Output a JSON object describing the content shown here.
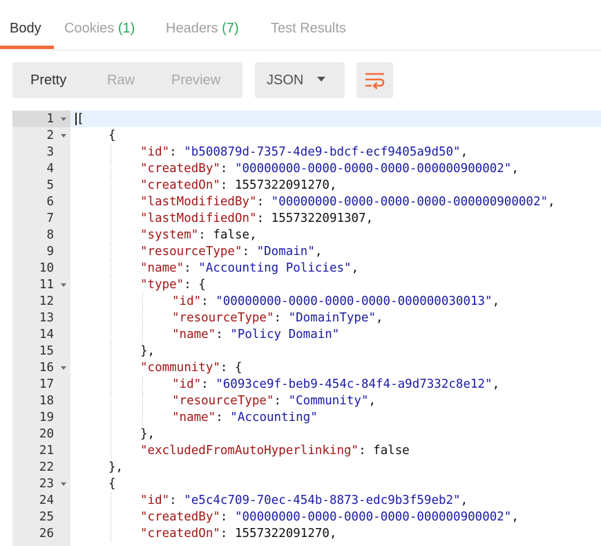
{
  "tabs": [
    {
      "label": "Body",
      "count": ""
    },
    {
      "label": "Cookies",
      "count": "(1)"
    },
    {
      "label": "Headers",
      "count": "(7)"
    },
    {
      "label": "Test Results",
      "count": ""
    }
  ],
  "view_modes": [
    "Pretty",
    "Raw",
    "Preview"
  ],
  "format": {
    "selected": "JSON"
  },
  "colors": {
    "accent": "#f26b3a",
    "count": "#26a65b",
    "key": "#a31515",
    "string": "#1a1aa6"
  },
  "icons": {
    "wrap": "wrap-lines-icon",
    "fold": "fold-arrow-icon",
    "dropdown": "chevron-down-icon"
  },
  "editor": {
    "lines": [
      {
        "n": "1",
        "i": 0,
        "fold": true,
        "p": [
          [
            "t",
            "["
          ]
        ]
      },
      {
        "n": "2",
        "i": 1,
        "fold": true,
        "p": [
          [
            "t",
            "{"
          ]
        ]
      },
      {
        "n": "3",
        "i": 2,
        "p": [
          [
            "k",
            "\"id\""
          ],
          [
            "t",
            ": "
          ],
          [
            "s",
            "\"b500879d-7357-4de9-bdcf-ecf9405a9d50\""
          ],
          [
            "t",
            ","
          ]
        ]
      },
      {
        "n": "4",
        "i": 2,
        "p": [
          [
            "k",
            "\"createdBy\""
          ],
          [
            "t",
            ": "
          ],
          [
            "s",
            "\"00000000-0000-0000-0000-000000900002\""
          ],
          [
            "t",
            ","
          ]
        ]
      },
      {
        "n": "5",
        "i": 2,
        "p": [
          [
            "k",
            "\"createdOn\""
          ],
          [
            "t",
            ": "
          ],
          [
            "n",
            "1557322091270"
          ],
          [
            "t",
            ","
          ]
        ]
      },
      {
        "n": "6",
        "i": 2,
        "p": [
          [
            "k",
            "\"lastModifiedBy\""
          ],
          [
            "t",
            ": "
          ],
          [
            "s",
            "\"00000000-0000-0000-0000-000000900002\""
          ],
          [
            "t",
            ","
          ]
        ]
      },
      {
        "n": "7",
        "i": 2,
        "p": [
          [
            "k",
            "\"lastModifiedOn\""
          ],
          [
            "t",
            ": "
          ],
          [
            "n",
            "1557322091307"
          ],
          [
            "t",
            ","
          ]
        ]
      },
      {
        "n": "8",
        "i": 2,
        "p": [
          [
            "k",
            "\"system\""
          ],
          [
            "t",
            ": "
          ],
          [
            "n",
            "false"
          ],
          [
            "t",
            ","
          ]
        ]
      },
      {
        "n": "9",
        "i": 2,
        "p": [
          [
            "k",
            "\"resourceType\""
          ],
          [
            "t",
            ": "
          ],
          [
            "s",
            "\"Domain\""
          ],
          [
            "t",
            ","
          ]
        ]
      },
      {
        "n": "10",
        "i": 2,
        "p": [
          [
            "k",
            "\"name\""
          ],
          [
            "t",
            ": "
          ],
          [
            "s",
            "\"Accounting Policies\""
          ],
          [
            "t",
            ","
          ]
        ]
      },
      {
        "n": "11",
        "i": 2,
        "fold": true,
        "p": [
          [
            "k",
            "\"type\""
          ],
          [
            "t",
            ": {"
          ]
        ]
      },
      {
        "n": "12",
        "i": 3,
        "p": [
          [
            "k",
            "\"id\""
          ],
          [
            "t",
            ": "
          ],
          [
            "s",
            "\"00000000-0000-0000-0000-000000030013\""
          ],
          [
            "t",
            ","
          ]
        ]
      },
      {
        "n": "13",
        "i": 3,
        "p": [
          [
            "k",
            "\"resourceType\""
          ],
          [
            "t",
            ": "
          ],
          [
            "s",
            "\"DomainType\""
          ],
          [
            "t",
            ","
          ]
        ]
      },
      {
        "n": "14",
        "i": 3,
        "p": [
          [
            "k",
            "\"name\""
          ],
          [
            "t",
            ": "
          ],
          [
            "s",
            "\"Policy Domain\""
          ]
        ]
      },
      {
        "n": "15",
        "i": 2,
        "p": [
          [
            "t",
            "},"
          ]
        ]
      },
      {
        "n": "16",
        "i": 2,
        "fold": true,
        "p": [
          [
            "k",
            "\"community\""
          ],
          [
            "t",
            ": {"
          ]
        ]
      },
      {
        "n": "17",
        "i": 3,
        "p": [
          [
            "k",
            "\"id\""
          ],
          [
            "t",
            ": "
          ],
          [
            "s",
            "\"6093ce9f-beb9-454c-84f4-a9d7332c8e12\""
          ],
          [
            "t",
            ","
          ]
        ]
      },
      {
        "n": "18",
        "i": 3,
        "p": [
          [
            "k",
            "\"resourceType\""
          ],
          [
            "t",
            ": "
          ],
          [
            "s",
            "\"Community\""
          ],
          [
            "t",
            ","
          ]
        ]
      },
      {
        "n": "19",
        "i": 3,
        "p": [
          [
            "k",
            "\"name\""
          ],
          [
            "t",
            ": "
          ],
          [
            "s",
            "\"Accounting\""
          ]
        ]
      },
      {
        "n": "20",
        "i": 2,
        "p": [
          [
            "t",
            "},"
          ]
        ]
      },
      {
        "n": "21",
        "i": 2,
        "p": [
          [
            "k",
            "\"excludedFromAutoHyperlinking\""
          ],
          [
            "t",
            ": "
          ],
          [
            "n",
            "false"
          ]
        ]
      },
      {
        "n": "22",
        "i": 1,
        "p": [
          [
            "t",
            "},"
          ]
        ]
      },
      {
        "n": "23",
        "i": 1,
        "fold": true,
        "p": [
          [
            "t",
            "{"
          ]
        ]
      },
      {
        "n": "24",
        "i": 2,
        "p": [
          [
            "k",
            "\"id\""
          ],
          [
            "t",
            ": "
          ],
          [
            "s",
            "\"e5c4c709-70ec-454b-8873-edc9b3f59eb2\""
          ],
          [
            "t",
            ","
          ]
        ]
      },
      {
        "n": "25",
        "i": 2,
        "p": [
          [
            "k",
            "\"createdBy\""
          ],
          [
            "t",
            ": "
          ],
          [
            "s",
            "\"00000000-0000-0000-0000-000000900002\""
          ],
          [
            "t",
            ","
          ]
        ]
      },
      {
        "n": "26",
        "i": 2,
        "p": [
          [
            "k",
            "\"createdOn\""
          ],
          [
            "t",
            ": "
          ],
          [
            "n",
            "1557322091270"
          ],
          [
            "t",
            ","
          ]
        ]
      }
    ]
  }
}
